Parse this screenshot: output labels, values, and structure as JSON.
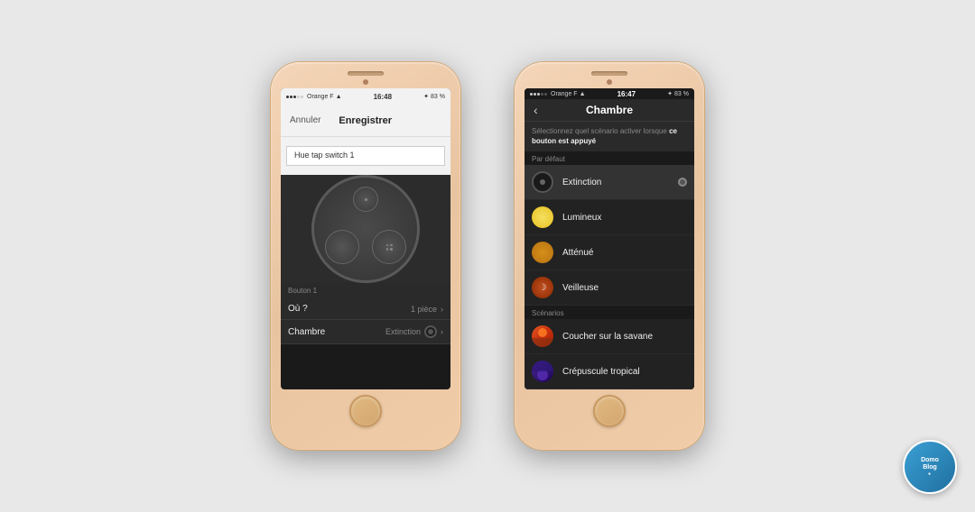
{
  "phone1": {
    "statusBar": {
      "carrier": "Orange F",
      "time": "16:48",
      "battery": "83 %"
    },
    "nav": {
      "cancel": "Annuler",
      "title": "Enregistrer"
    },
    "input": {
      "value": "Hue tap switch 1"
    },
    "buttons": {
      "center_label": "center",
      "bl_label": "bottom-left",
      "br_label": "bottom-right"
    },
    "boutonLabel": "Bouton 1",
    "rows": [
      {
        "label": "Où ?",
        "value": "1 pièce",
        "hasChevron": true
      },
      {
        "label": "Chambre",
        "value": "Extinction",
        "hasToggle": true,
        "hasChevron": true
      }
    ]
  },
  "phone2": {
    "statusBar": {
      "carrier": "Orange F",
      "time": "16:47",
      "battery": "83 %"
    },
    "nav": {
      "title": "Chambre",
      "backIcon": "‹"
    },
    "subtitle": "Sélectionnez quel scénario activer lorsque",
    "subtitleBold": "ce bouton est appuyé",
    "sectionDefault": "Par défaut",
    "sectionScenarios": "Scénarios",
    "items": [
      {
        "id": "extinction",
        "label": "Extinction",
        "iconType": "extinction",
        "selected": true
      },
      {
        "id": "lumineux",
        "label": "Lumineux",
        "iconType": "lumineux",
        "selected": false
      },
      {
        "id": "attenue",
        "label": "Atténué",
        "iconType": "attenue",
        "selected": false
      },
      {
        "id": "veilleuse",
        "label": "Veilleuse",
        "iconType": "veilleuse",
        "selected": false
      }
    ],
    "scenarios": [
      {
        "id": "coucher",
        "label": "Coucher sur la savane",
        "iconType": "coucher"
      },
      {
        "id": "crepuscule",
        "label": "Crépuscule tropical",
        "iconType": "crepuscule"
      }
    ]
  },
  "watermark": {
    "line1": "Domo",
    "line2": "Blog"
  }
}
